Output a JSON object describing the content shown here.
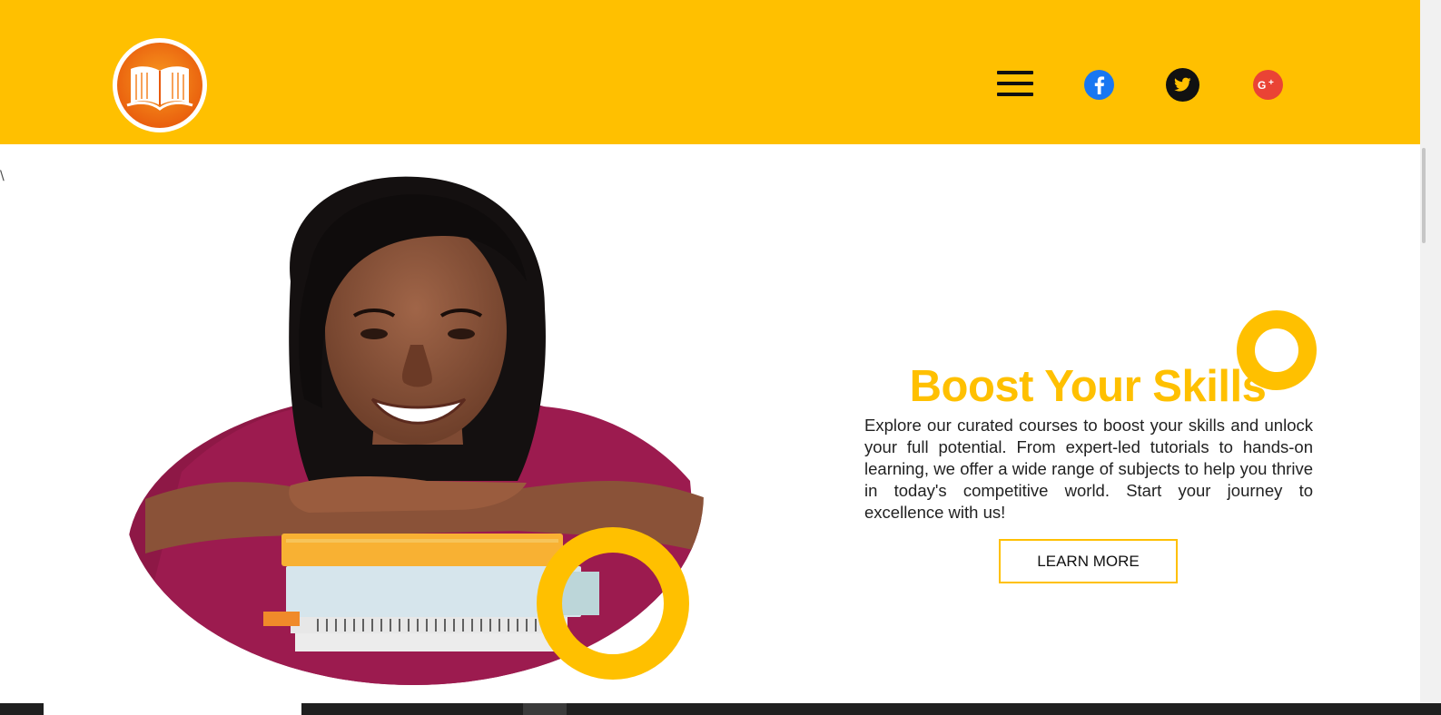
{
  "header": {
    "logo_alt": "book-logo",
    "background_color": "#FFC000",
    "nav": {
      "menu_icon": "hamburger-menu-icon",
      "social": [
        {
          "name": "facebook",
          "icon": "facebook-icon",
          "color": "#1877F2"
        },
        {
          "name": "twitter",
          "icon": "twitter-icon",
          "color": "#111111"
        },
        {
          "name": "google-plus",
          "icon": "google-plus-icon",
          "color": "#EA4335"
        }
      ]
    }
  },
  "stray_text": "\\",
  "hero": {
    "title": "Boost Your Skills",
    "description": "Explore our curated courses to boost your skills and unlock your full potential. From expert-led tutorials to hands-on learning, we offer a wide range of subjects to help you thrive in today's competitive world. Start your journey to excellence with us!",
    "cta_label": "LEARN MORE",
    "accent_color": "#FFC000",
    "image_subject": "smiling student resting on a stack of books"
  }
}
